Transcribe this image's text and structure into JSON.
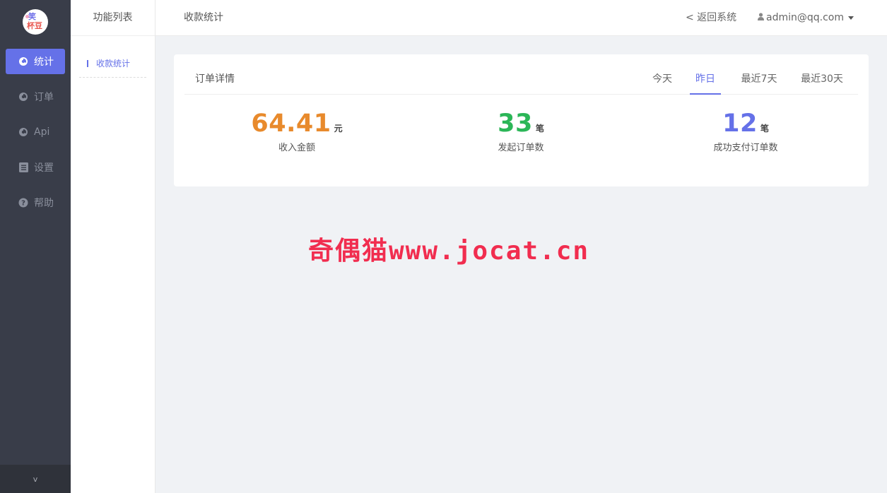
{
  "sidebar": {
    "logo": {
      "line1": "笑",
      "line2": "杯豆",
      "accent": "#6d6ee8"
    },
    "items": [
      {
        "label": "统计",
        "icon": "chart-pie-icon",
        "active": true
      },
      {
        "label": "订单",
        "icon": "chart-pie-icon",
        "active": false
      },
      {
        "label": "Api",
        "icon": "chart-pie-icon",
        "active": false
      },
      {
        "label": "设置",
        "icon": "list-icon",
        "active": false
      },
      {
        "label": "帮助",
        "icon": "question-circle-icon",
        "active": false
      }
    ],
    "collapse_label": "v",
    "active_color": "#6571e8"
  },
  "subpanel": {
    "title": "功能列表",
    "items": [
      {
        "label": "收款统计",
        "active": true
      }
    ]
  },
  "header": {
    "title": "收款统计",
    "back_label": "< 返回系统",
    "user": "admin@qq.com"
  },
  "card": {
    "title": "订单详情",
    "tabs": [
      {
        "label": "今天",
        "active": false
      },
      {
        "label": "昨日",
        "active": true
      },
      {
        "label": "最近7天",
        "active": false
      },
      {
        "label": "最近30天",
        "active": false
      }
    ],
    "stats": [
      {
        "value": "64.41",
        "unit": "元",
        "label": "收入金额",
        "color": "#e88a2c"
      },
      {
        "value": "33",
        "unit": "笔",
        "label": "发起订单数",
        "color": "#2bb657"
      },
      {
        "value": "12",
        "unit": "笔",
        "label": "成功支付订单数",
        "color": "#6571e8"
      }
    ]
  },
  "watermark": "奇偶猫www.jocat.cn"
}
